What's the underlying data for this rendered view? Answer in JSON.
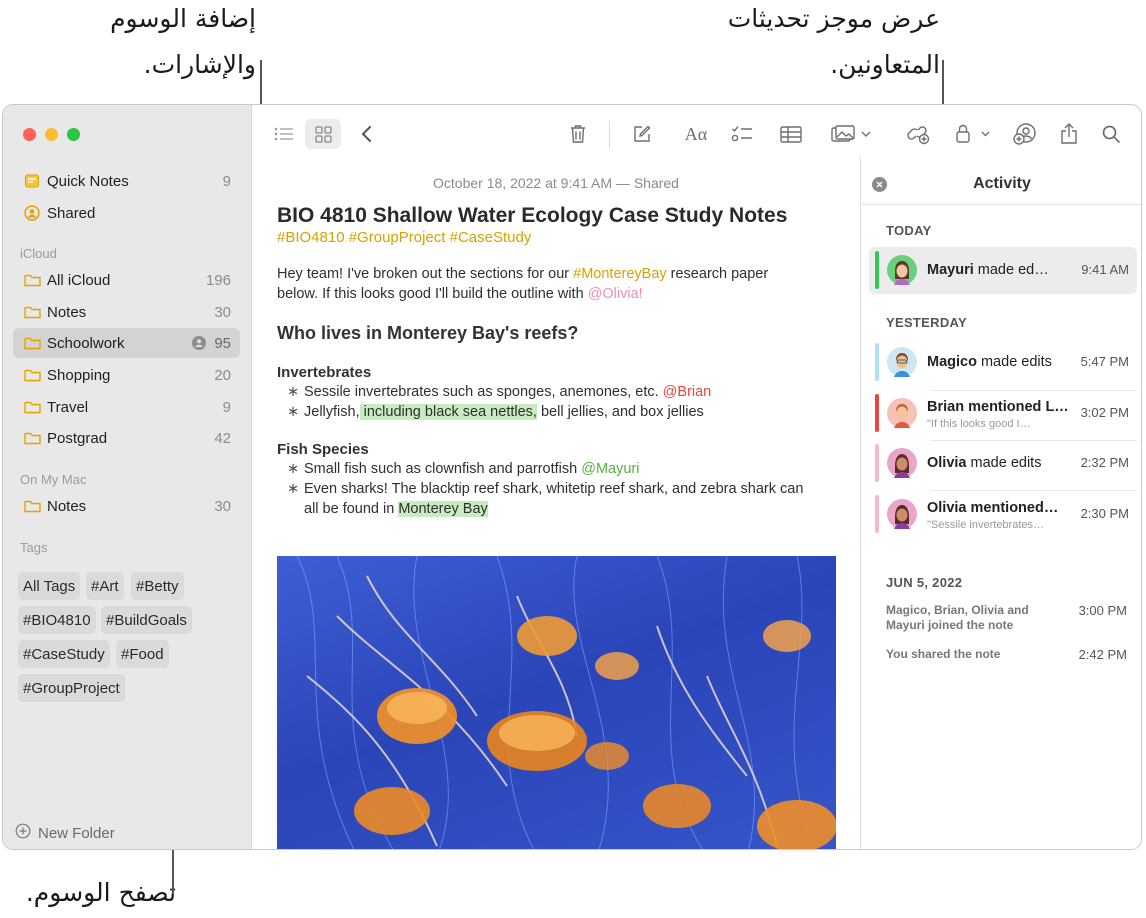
{
  "callouts": {
    "tags_mentions": "إضافة الوسوم والإشارات.",
    "activity_feed": "عرض موجز تحديثات المتعاونين.",
    "browse_tags": "تصفح الوسوم."
  },
  "sidebar": {
    "quick_notes": {
      "label": "Quick Notes",
      "count": "9"
    },
    "shared": {
      "label": "Shared"
    },
    "icloud_header": "iCloud",
    "icloud_items": [
      {
        "label": "All iCloud",
        "count": "196"
      },
      {
        "label": "Notes",
        "count": "30"
      },
      {
        "label": "Schoolwork",
        "count": "95"
      },
      {
        "label": "Shopping",
        "count": "20"
      },
      {
        "label": "Travel",
        "count": "9"
      },
      {
        "label": "Postgrad",
        "count": "42"
      }
    ],
    "mac_header": "On My Mac",
    "mac_items": [
      {
        "label": "Notes",
        "count": "30"
      }
    ],
    "tags_header": "Tags",
    "tags": [
      "All Tags",
      "#Art",
      "#Betty",
      "#BIO4810",
      "#BuildGoals",
      "#CaseStudy",
      "#Food",
      "#GroupProject"
    ],
    "new_folder": "New Folder"
  },
  "note": {
    "meta": "October 18, 2022 at 9:41 AM — Shared",
    "title": "BIO 4810 Shallow Water Ecology Case Study Notes",
    "tags_line": "#BIO4810 #GroupProject #CaseStudy",
    "intro_1": "Hey team! I've broken out the sections for our ",
    "intro_tag": "#MontereyBay",
    "intro_2": " research paper",
    "intro_3": "below. If this looks good I'll build the outline with ",
    "intro_mention": "@Olivia!",
    "heading": "Who lives in Monterey Bay's reefs?",
    "sub1": "Invertebrates",
    "b1_text": "Sessile invertebrates such as sponges, anemones, etc. ",
    "b1_mention": "@Brian",
    "b2_a": "Jellyfish,",
    "b2_hl": " including black sea nettles,",
    "b2_b": " bell jellies, and box jellies",
    "sub2": "Fish Species",
    "b3_text": "Small fish such as clownfish and parrotfish ",
    "b3_mention": "@Mayuri",
    "b4_a": "Even sharks! The blacktip reef shark, whitetip reef shark, and zebra shark can",
    "b4_b": "all be found in ",
    "b4_hl": "Monterey Bay",
    "bullet_char": "∗"
  },
  "activity": {
    "title": "Activity",
    "today": "TODAY",
    "yesterday": "YESTERDAY",
    "june": "JUN 5, 2022",
    "rows": [
      {
        "name": "Mayuri",
        "action": " made ed…",
        "sub": "",
        "time": "9:41 AM",
        "color": "#34c759"
      },
      {
        "name": "Magico",
        "action": " made edits",
        "sub": "",
        "time": "5:47 PM",
        "color": "#aee3f5"
      },
      {
        "name": "Brian",
        "action": " mentioned L…",
        "sub": "\"If this looks good I…",
        "time": "3:02 PM",
        "color": "#e5483d"
      },
      {
        "name": "Olivia",
        "action": " made edits",
        "sub": "",
        "time": "2:32 PM",
        "color": "#f6b8cf"
      },
      {
        "name": "Olivia",
        "action": " mentioned…",
        "sub": "\"Sessile invertebrates…",
        "time": "2:30 PM",
        "color": "#f6b8cf"
      }
    ],
    "joined": "Magico, Brian, Olivia and Mayuri joined the note",
    "joined_time": "3:00 PM",
    "shared_note": "You shared the note",
    "shared_time": "2:42 PM"
  },
  "icons": [
    "list-view-icon",
    "gallery-view-icon",
    "back-icon",
    "trash-icon",
    "compose-icon",
    "format-icon",
    "checklist-icon",
    "table-icon",
    "media-icon",
    "collaborate-icon",
    "lock-icon",
    "share-people-icon",
    "share-icon",
    "search-icon"
  ]
}
